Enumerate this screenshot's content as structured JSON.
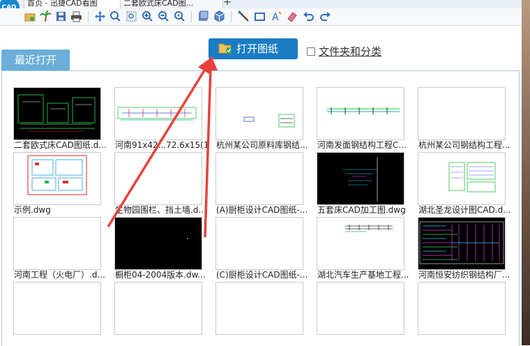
{
  "tabs": [
    {
      "label": "首页 - 迅捷CAD看图"
    },
    {
      "label": "二套欧式床CAD图..."
    }
  ],
  "tab_add_symbol": "+",
  "logo_text": "CAD",
  "toolbar": {
    "icons": [
      "open-icon",
      "palm-tree-icon",
      "save-icon",
      "print-icon",
      "move-icon",
      "zoom-window-icon",
      "zoom-extents-icon",
      "zoom-in-icon",
      "zoom-out-icon",
      "zoom-previous-icon",
      "layers-icon",
      "3d-box-icon",
      "line-measure-icon",
      "rectangle-measure-icon",
      "text-icon",
      "eraser-icon",
      "undo-icon",
      "redo-icon"
    ]
  },
  "recent_label": "最近打开",
  "open_button_label": "打开图纸",
  "folder_category_label": "文件夹和分类",
  "files": [
    {
      "name": "二套欧式床CAD图纸.d...",
      "thumb": "black-drawing"
    },
    {
      "name": "河南91x42...72.6x15(1...",
      "thumb": "white-colored-strip"
    },
    {
      "name": "杭州某公司原料库钢结...",
      "thumb": "white-small-block"
    },
    {
      "name": "河南发面钢结构工程C...",
      "thumb": "white-green-strip"
    },
    {
      "name": "杭州某公司钢结构工程...",
      "thumb": "blank"
    },
    {
      "name": "示例.dwg",
      "thumb": "white-red-plan"
    },
    {
      "name": "生物园围栏、挡土墙.d...",
      "thumb": "blank"
    },
    {
      "name": "(A)厨柜设计CAD图纸-...",
      "thumb": "blank"
    },
    {
      "name": "五套床CAD加工图.dwg",
      "thumb": "black-sparse"
    },
    {
      "name": "湖北圣龙设计图CAD.d...",
      "thumb": "white-green-tables"
    },
    {
      "name": "河南工程（火电厂）.d...",
      "thumb": "blank"
    },
    {
      "name": "橱柜04-2004版本.dw...",
      "thumb": "black-empty"
    },
    {
      "name": "(C)厨柜设计CAD图纸-...",
      "thumb": "blank"
    },
    {
      "name": "湖北汽车生产基地工程...",
      "thumb": "white-small-strip"
    },
    {
      "name": "河南恒安纺织钢结构厂...",
      "thumb": "black-dense"
    },
    {
      "name": "",
      "thumb": "blank"
    },
    {
      "name": "",
      "thumb": "blank"
    },
    {
      "name": "",
      "thumb": "blank"
    },
    {
      "name": "",
      "thumb": "blank"
    },
    {
      "name": "",
      "thumb": "blank"
    }
  ],
  "colors": {
    "accent_blue": "#1a7cc4",
    "recent_tab": "#6aaed9",
    "annotation_arrow": "#e8423a"
  }
}
